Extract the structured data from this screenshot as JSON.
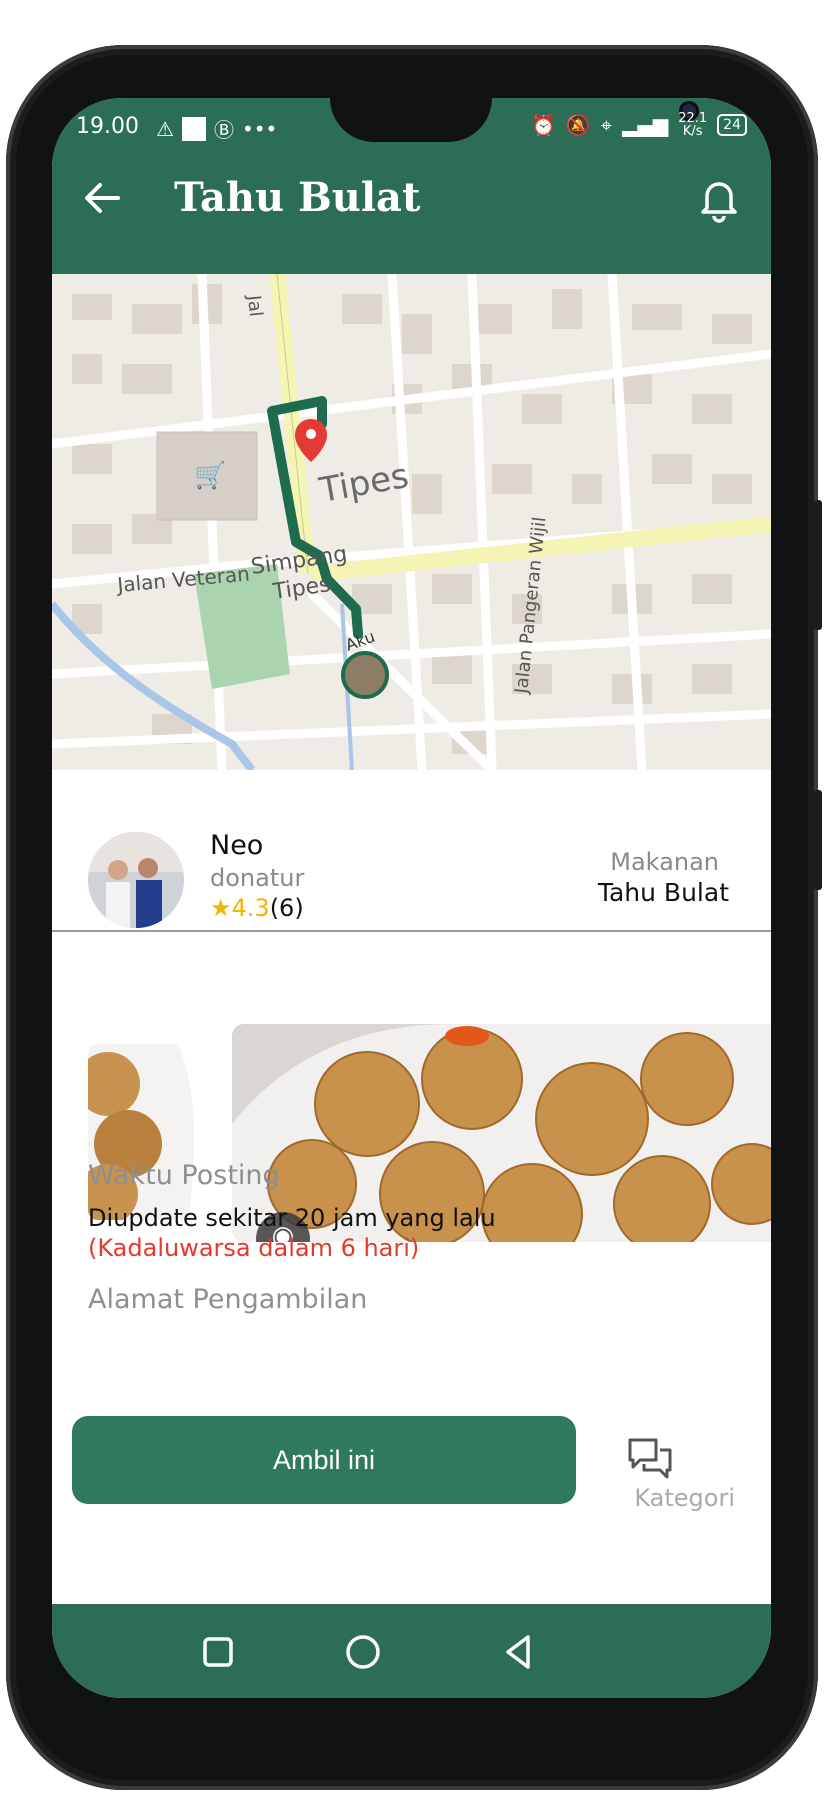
{
  "status_bar": {
    "time": "19.00",
    "left_icons": [
      "warning-icon",
      "white-square",
      "b-circle-icon",
      "more-dots-icon"
    ],
    "right_icons": [
      "alarm-icon",
      "mute-bell-icon",
      "location-icon",
      "signal-4g-icon"
    ],
    "network_speed_value": "22.1",
    "network_speed_unit": "K/s",
    "battery": "24"
  },
  "app_bar": {
    "title": "Tahu Bulat",
    "back_icon": "arrow-left-icon",
    "bell_icon": "bell-icon"
  },
  "map": {
    "labels": [
      "Tipes",
      "Jalan Veteran",
      "Simpang",
      "Tipes",
      "Jalan Pangeran Wijil",
      "Jal"
    ],
    "user_marker_label": "Aku",
    "route_color": "#1f6b4e",
    "pin_color": "#e53935"
  },
  "donor": {
    "name": "Neo",
    "role": "donatur",
    "star": "★",
    "rating": "4.3",
    "reviews": "(6)",
    "category_label": "Makanan",
    "category_value": "Tahu Bulat"
  },
  "photos": {
    "camera_icon": "camera-icon"
  },
  "details": {
    "posting_label": "Waktu Posting",
    "posting_value": "Diupdate sekitar 20 jam yang lalu",
    "expiry": "(Kadaluwarsa dalam 6 hari)",
    "address_label": "Alamat Pengambilan",
    "kategori_ghost": "Kategori"
  },
  "actions": {
    "take_label": "Ambil ini",
    "chat_icon": "chat-icon"
  },
  "nav_bar": {
    "items": [
      "square-icon",
      "circle-icon",
      "triangle-back-icon"
    ]
  },
  "colors": {
    "primary": "#2b6e55",
    "button": "#2f7a5c",
    "star": "#f2b600",
    "warning_red": "#e23b2e"
  }
}
